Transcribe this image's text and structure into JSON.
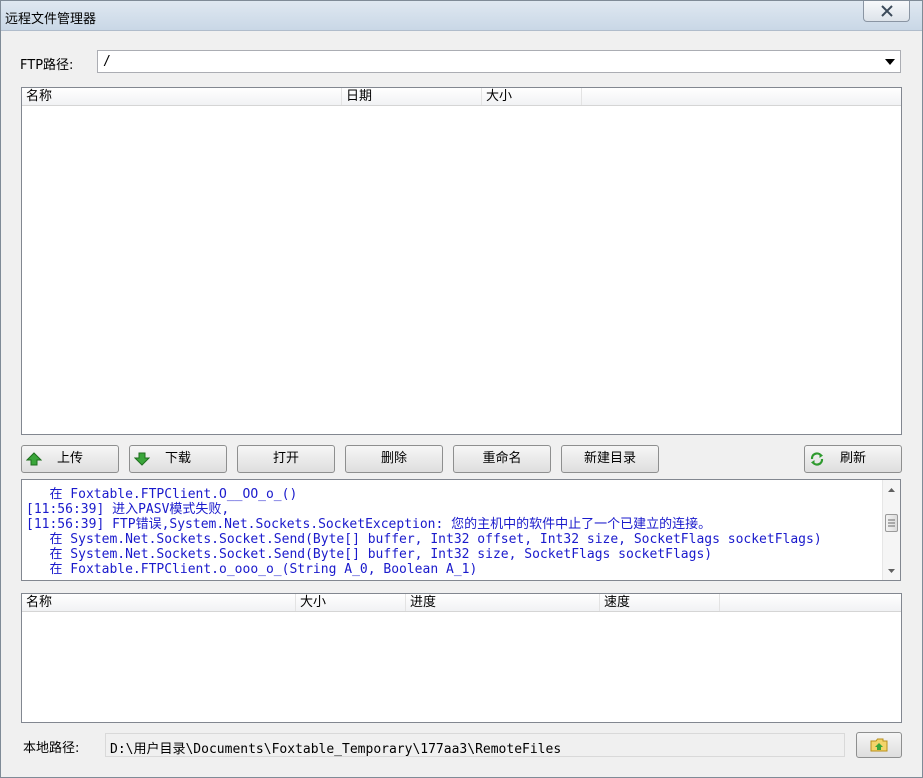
{
  "window": {
    "title": "远程文件管理器"
  },
  "ftp_path": {
    "label": "FTP路径:",
    "value": "/"
  },
  "remote_list": {
    "columns": [
      "名称",
      "日期",
      "大小"
    ],
    "rows": []
  },
  "toolbar": {
    "upload": "上传",
    "download": "下载",
    "open": "打开",
    "delete": "删除",
    "rename": "重命名",
    "new_dir": "新建目录",
    "refresh": "刷新"
  },
  "log": {
    "lines": [
      "   在 Foxtable.FTPClient.O__OO_o_()",
      "[11:56:39] 进入PASV模式失败,",
      "[11:56:39] FTP错误,System.Net.Sockets.SocketException: 您的主机中的软件中止了一个已建立的连接。",
      "   在 System.Net.Sockets.Socket.Send(Byte[] buffer, Int32 offset, Int32 size, SocketFlags socketFlags)",
      "   在 System.Net.Sockets.Socket.Send(Byte[] buffer, Int32 size, SocketFlags socketFlags)",
      "   在 Foxtable.FTPClient.o_ooo_o_(String A_0, Boolean A_1)"
    ]
  },
  "transfer_list": {
    "columns": [
      "名称",
      "大小",
      "进度",
      "速度"
    ],
    "rows": []
  },
  "local_path": {
    "label": "本地路径:",
    "value": "D:\\用户目录\\Documents\\Foxtable_Temporary\\177aa3\\RemoteFiles"
  },
  "colors": {
    "log_text": "#1a1acc",
    "upload_icon": "#3aa63a",
    "refresh_icon": "#2e9a2e"
  }
}
